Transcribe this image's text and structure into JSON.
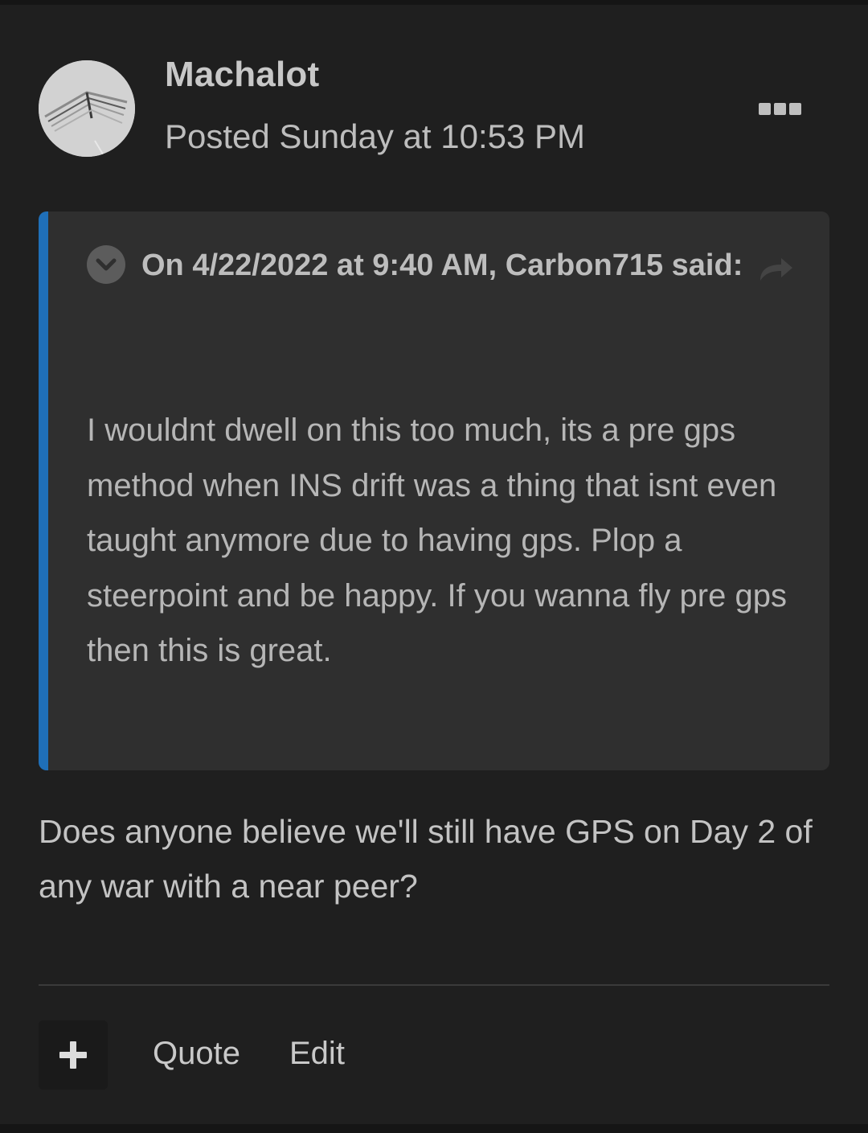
{
  "post": {
    "author": "Machalot",
    "posted": "Posted Sunday at 10:53 PM"
  },
  "quote": {
    "citation": "On 4/22/2022 at 9:40 AM, Carbon715 said:",
    "text": "I wouldnt dwell on this too much, its a pre gps method when INS drift was a thing that isnt even taught anymore due to having gps. Plop a steerpoint and be happy. If you wanna fly pre gps then this is great.",
    "accent_color": "#1f6fb8"
  },
  "reply": {
    "text": "Does anyone believe we'll still have GPS on Day 2 of any war with a near peer?"
  },
  "actions": {
    "plus_icon": "plus-icon",
    "quote_label": "Quote",
    "edit_label": "Edit"
  },
  "icons": {
    "more": "ellipsis-icon",
    "toggle": "chevron-down-icon",
    "share": "share-arrow-icon"
  }
}
